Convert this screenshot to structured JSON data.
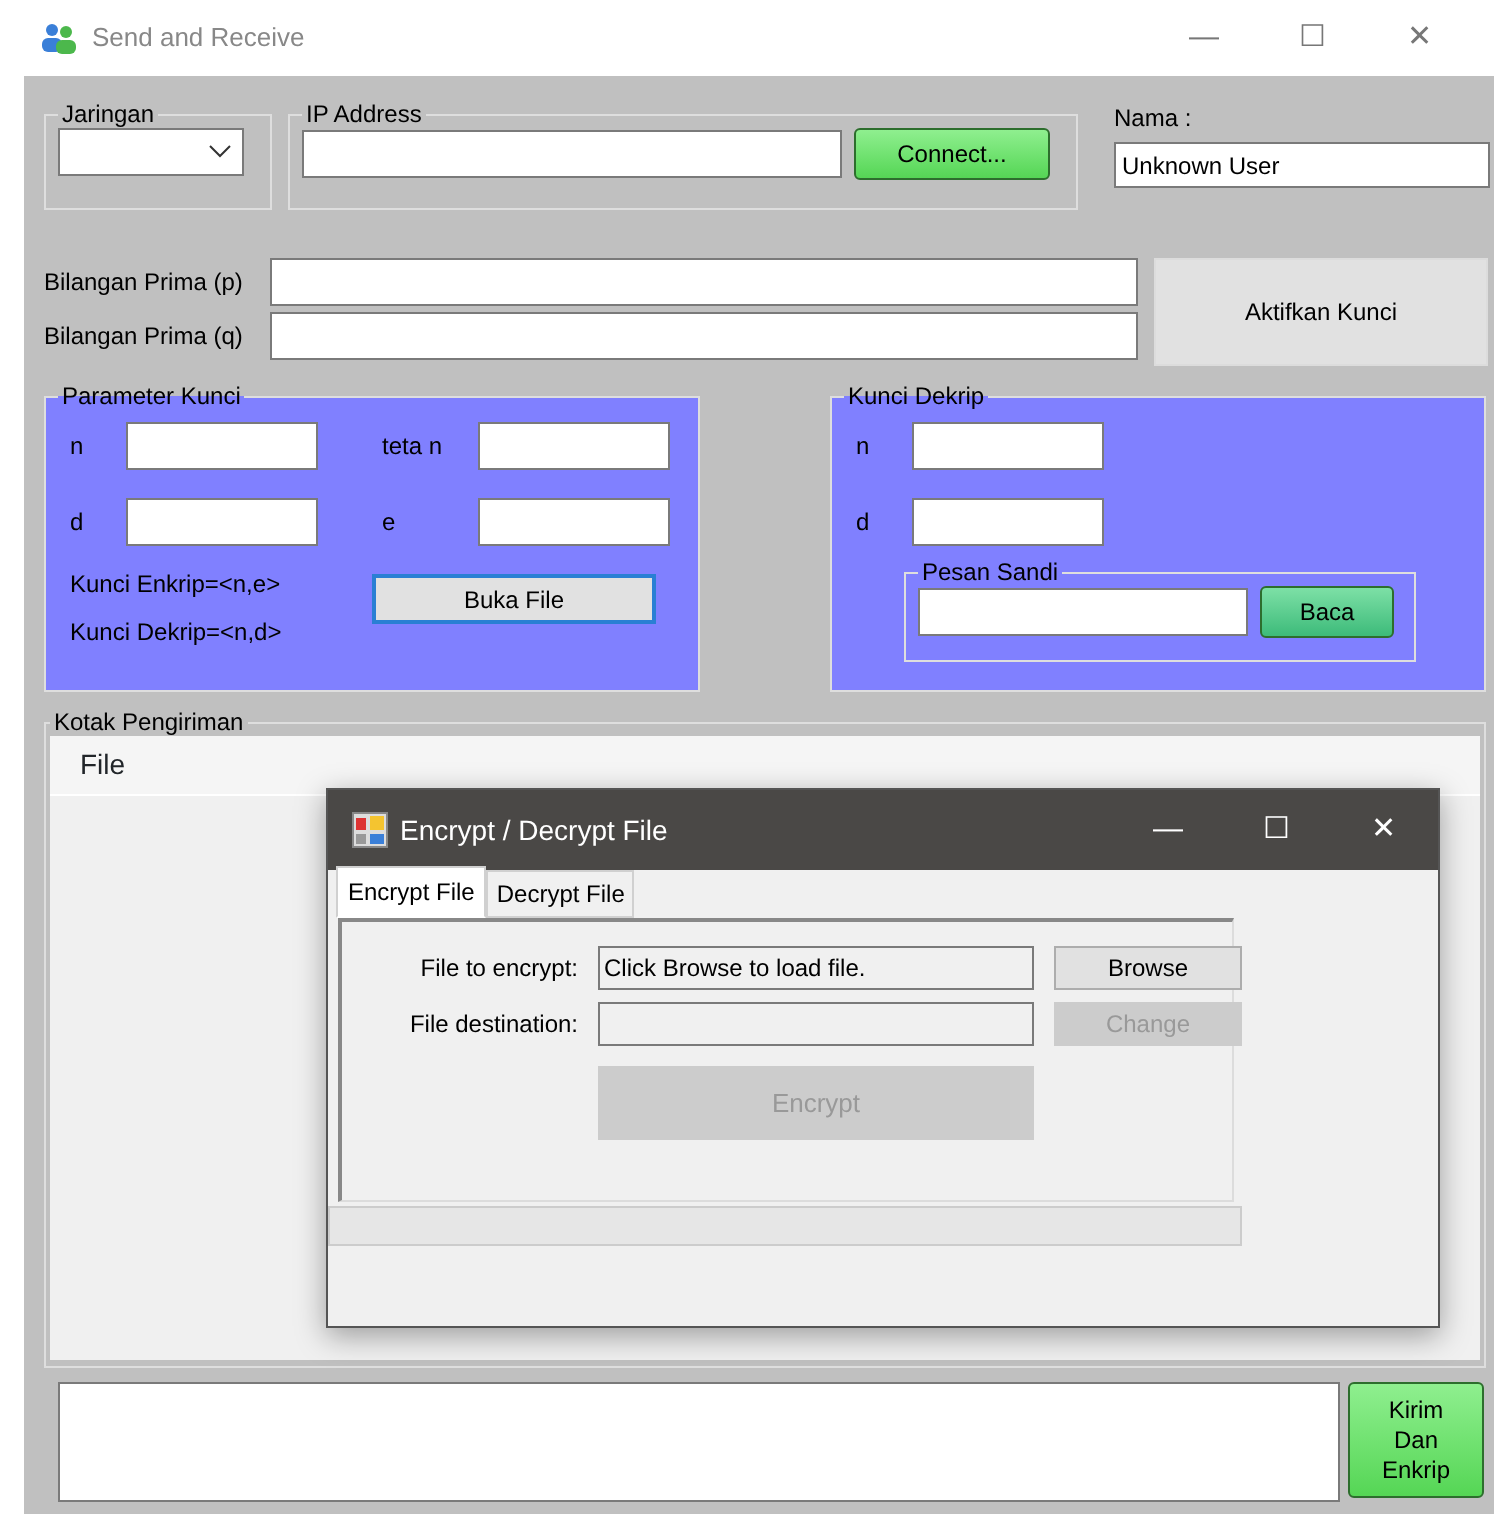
{
  "window": {
    "title": "Send and Receive",
    "controls": [
      "—",
      "☐",
      "✕"
    ]
  },
  "network": {
    "label": "Jaringan"
  },
  "ip_address": {
    "label": "IP Address",
    "button": "Connect..."
  },
  "user_name": {
    "label": "Nama :",
    "value": "Unknown User"
  },
  "primes": [
    {
      "label": "Bilangan Prima (p)"
    },
    {
      "label": "Bilangan Prima (q)"
    }
  ],
  "activate_button": "Aktifkan Kunci",
  "key_parameters": {
    "title": "Parameter Kunci",
    "fields": [
      {
        "label": "n"
      },
      {
        "label": "teta n"
      },
      {
        "label": "d"
      },
      {
        "label": "e"
      }
    ],
    "notes": [
      "Kunci Enkrip=<n,e>",
      "Kunci Dekrip=<n,d>"
    ],
    "button": "Buka File"
  },
  "decrypt_key": {
    "title": "Kunci Dekrip",
    "fields": [
      {
        "label": "n"
      },
      {
        "label": "d"
      }
    ],
    "cipher": {
      "title": "Pesan Sandi",
      "button": "Baca"
    }
  },
  "send_box": {
    "title": "Kotak Pengiriman",
    "menu": [
      "File"
    ]
  },
  "send_button": "Kirim Dan Enkrip",
  "dialog": {
    "title": "Encrypt / Decrypt File",
    "controls": [
      "—",
      "☐",
      "✕"
    ],
    "tabs": [
      {
        "label": "Encrypt File",
        "selected": true
      },
      {
        "label": "Decrypt File",
        "selected": false
      }
    ],
    "rows": [
      {
        "label": "File to encrypt:",
        "value": "Click Browse to load file.",
        "button": "Browse",
        "disabled": false
      },
      {
        "label": "File destination:",
        "value": "",
        "button": "Change",
        "disabled": true
      }
    ],
    "action": {
      "label": "Encrypt",
      "disabled": true
    }
  }
}
